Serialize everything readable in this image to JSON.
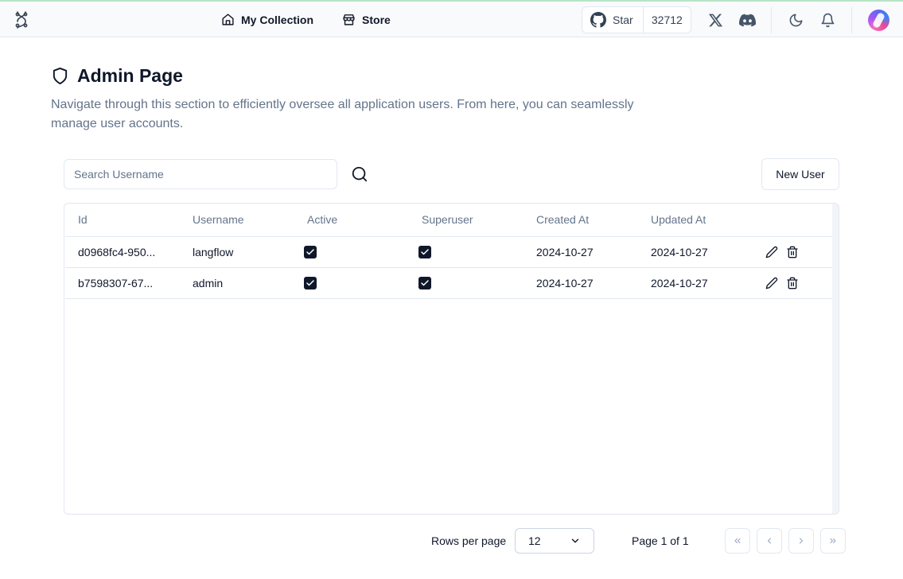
{
  "header": {
    "nav": [
      {
        "label": "My Collection",
        "icon": "home-icon"
      },
      {
        "label": "Store",
        "icon": "store-icon"
      }
    ],
    "github": {
      "star_label": "Star",
      "count": "32712"
    }
  },
  "page": {
    "title": "Admin Page",
    "description": "Navigate through this section to efficiently oversee all application users. From here, you can seamlessly manage user accounts."
  },
  "search": {
    "placeholder": "Search Username"
  },
  "new_user_label": "New User",
  "table": {
    "columns": [
      "Id",
      "Username",
      "Active",
      "Superuser",
      "Created At",
      "Updated At"
    ],
    "rows": [
      {
        "id": "d0968fc4-950...",
        "username": "langflow",
        "active": true,
        "superuser": true,
        "created_at": "2024-10-27",
        "updated_at": "2024-10-27"
      },
      {
        "id": "b7598307-67...",
        "username": "admin",
        "active": true,
        "superuser": true,
        "created_at": "2024-10-27",
        "updated_at": "2024-10-27"
      }
    ]
  },
  "pagination": {
    "rows_per_page_label": "Rows per page",
    "rows_per_page_value": "12",
    "page_info": "Page 1 of 1"
  }
}
